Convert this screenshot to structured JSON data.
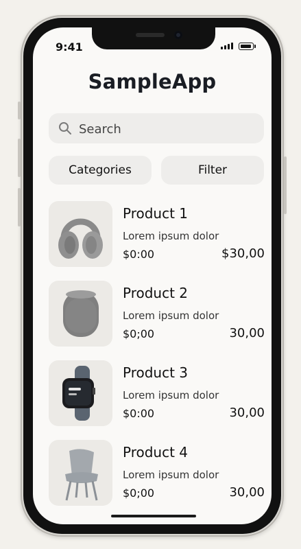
{
  "status_bar": {
    "time": "9:41"
  },
  "app": {
    "title": "SampleApp"
  },
  "search": {
    "placeholder": "Search"
  },
  "filters": {
    "categories_label": "Categories",
    "filter_label": "Filter"
  },
  "products": [
    {
      "name": "Product 1",
      "description": "Lorem ipsum dolor",
      "price_left": "$0:00",
      "price_right": "$30,00",
      "image": "headphones"
    },
    {
      "name": "Product 2",
      "description": "Lorem ipsum dolor",
      "price_left": "$0;00",
      "price_right": "30,00",
      "image": "smart-speaker"
    },
    {
      "name": "Product 3",
      "description": "Lorem ipsum dolor",
      "price_left": "$0:00",
      "price_right": "30,00",
      "image": "smartwatch"
    },
    {
      "name": "Product 4",
      "description": "Lorem ipsum dolor",
      "price_left": "$0;00",
      "price_right": "30,00",
      "image": "chair"
    }
  ],
  "icons": {
    "search": "search-icon",
    "signal": "cellular-signal-icon",
    "battery": "battery-icon"
  }
}
